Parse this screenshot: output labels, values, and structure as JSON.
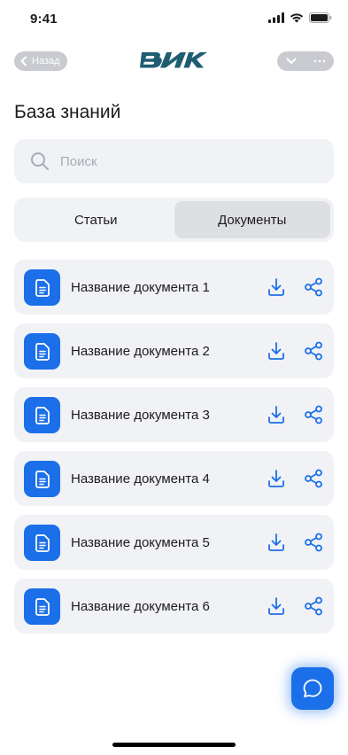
{
  "status_bar": {
    "time": "9:41"
  },
  "nav": {
    "back_label": "Назад",
    "logo_text": "ВИК",
    "colors": {
      "pill": "#c9cbd0",
      "logo": "#1f5d72"
    }
  },
  "page": {
    "title": "База знаний"
  },
  "search": {
    "placeholder": "Поиск",
    "value": ""
  },
  "tabs": {
    "items": [
      {
        "label": "Статьи",
        "active": false
      },
      {
        "label": "Документы",
        "active": true
      }
    ]
  },
  "documents": [
    {
      "name": "Название документа 1"
    },
    {
      "name": "Название документа 2"
    },
    {
      "name": "Название документа 3"
    },
    {
      "name": "Название документа 4"
    },
    {
      "name": "Название документа 5"
    },
    {
      "name": "Название документа 6"
    }
  ],
  "icons": {
    "document": "document-icon",
    "download": "download-icon",
    "share": "share-icon",
    "chat": "chat-bubble-icon",
    "search": "search-icon"
  },
  "colors": {
    "accent": "#1b6fe8",
    "card_background": "#f1f2f6",
    "active_tab": "#dedfe3",
    "text": "#1c1c1e",
    "placeholder": "#a9acb3"
  }
}
